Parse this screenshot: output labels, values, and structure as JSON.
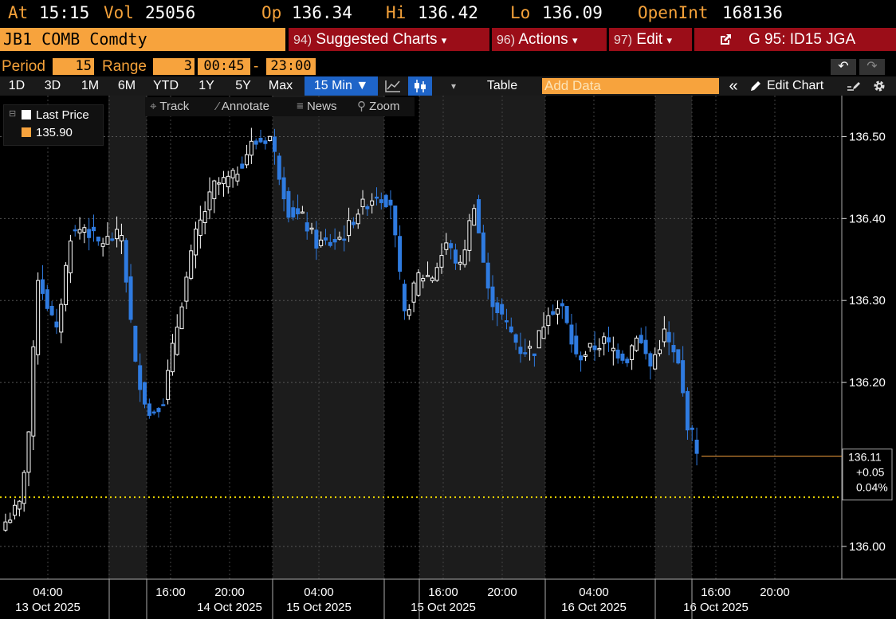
{
  "header": {
    "at_label": "At",
    "at_value": "15:15",
    "vol_label": "Vol",
    "vol_value": "25056",
    "op_label": "Op",
    "op_value": "136.34",
    "hi_label": "Hi",
    "hi_value": "136.42",
    "lo_label": "Lo",
    "lo_value": "136.09",
    "oi_label": "OpenInt",
    "oi_value": "168136"
  },
  "ticker": {
    "value": "JB1 COMB Comdty"
  },
  "menus": {
    "suggested": {
      "num": "94)",
      "label": "Suggested Charts",
      "arrow": "▾"
    },
    "actions": {
      "num": "96)",
      "label": "Actions",
      "arrow": "▾"
    },
    "edit": {
      "num": "97)",
      "label": "Edit",
      "arrow": "▾"
    },
    "launch": {
      "label": "G 95: ID15 JGA"
    }
  },
  "params": {
    "period_label": "Period",
    "period_value": "15",
    "range_label": "Range",
    "range_value": "3",
    "start_time": "00:45",
    "range_sep": "-",
    "end_time": "23:00",
    "undo": "↶",
    "redo": "↷"
  },
  "toolbar": {
    "ranges": [
      "1D",
      "3D",
      "1M",
      "6M",
      "YTD",
      "1Y",
      "5Y",
      "Max"
    ],
    "interval": "15 Min ▼",
    "table": "Table",
    "add_data_placeholder": "Add Data",
    "collapse": "«",
    "edit_chart": "Edit Chart"
  },
  "tools": {
    "track": "Track",
    "annotate": "Annotate",
    "news": "News",
    "zoom": "Zoom"
  },
  "legend": {
    "series": "Last Price",
    "value": "135.90",
    "swatch_color": "#f7a33d"
  },
  "colors": {
    "accent": "#f7a33d",
    "menu_red": "#9b0d18",
    "selected_blue": "#1e64c8",
    "down_candle": "#2f7be0"
  },
  "chart_data": {
    "type": "candlestick",
    "ylim": [
      135.96,
      136.55
    ],
    "yticks": [
      {
        "value": 136.5,
        "label": "136.50"
      },
      {
        "value": 136.4,
        "label": "136.40"
      },
      {
        "value": 136.3,
        "label": "136.30"
      },
      {
        "value": 136.2,
        "label": "136.20"
      },
      {
        "value": 136.0,
        "label": "136.00"
      }
    ],
    "xticks": [
      {
        "time": "04:00",
        "date": "13 Oct 2025"
      },
      {
        "time": "16:00",
        "date": ""
      },
      {
        "time": "20:00",
        "date": "14 Oct 2025"
      },
      {
        "time": "04:00",
        "date": "15 Oct 2025"
      },
      {
        "time": "16:00",
        "date": "15 Oct 2025"
      },
      {
        "time": "20:00",
        "date": ""
      },
      {
        "time": "04:00",
        "date": "16 Oct 2025"
      },
      {
        "time": "16:00",
        "date": "16 Oct 2025"
      },
      {
        "time": "20:00",
        "date": ""
      }
    ],
    "last_price": {
      "value": 136.11,
      "label": "136.11",
      "change": "+0.05",
      "pct": "0.04%"
    },
    "reference_level": 136.06,
    "control_points": [
      [
        0,
        136.03
      ],
      [
        3,
        136.05
      ],
      [
        5,
        136.14
      ],
      [
        7,
        136.33
      ],
      [
        11,
        136.26
      ],
      [
        14,
        136.38
      ],
      [
        17,
        136.39
      ],
      [
        20,
        136.37
      ],
      [
        25,
        136.38
      ],
      [
        28,
        136.22
      ],
      [
        31,
        136.16
      ],
      [
        34,
        136.18
      ],
      [
        38,
        136.3
      ],
      [
        41,
        136.38
      ],
      [
        45,
        136.44
      ],
      [
        49,
        136.45
      ],
      [
        53,
        136.49
      ],
      [
        57,
        136.5
      ],
      [
        61,
        136.41
      ],
      [
        64,
        136.4
      ],
      [
        67,
        136.37
      ],
      [
        70,
        136.37
      ],
      [
        73,
        136.38
      ],
      [
        76,
        136.41
      ],
      [
        80,
        136.43
      ],
      [
        83,
        136.42
      ],
      [
        86,
        136.28
      ],
      [
        89,
        136.33
      ],
      [
        92,
        136.33
      ],
      [
        95,
        136.37
      ],
      [
        98,
        136.34
      ],
      [
        101,
        136.42
      ],
      [
        104,
        136.31
      ],
      [
        107,
        136.28
      ],
      [
        111,
        136.24
      ],
      [
        114,
        136.24
      ],
      [
        117,
        136.29
      ],
      [
        120,
        136.29
      ],
      [
        123,
        136.23
      ],
      [
        126,
        136.24
      ],
      [
        129,
        136.25
      ],
      [
        131,
        136.24
      ],
      [
        134,
        136.23
      ],
      [
        136,
        136.26
      ],
      [
        139,
        136.22
      ],
      [
        142,
        136.26
      ],
      [
        145,
        136.22
      ],
      [
        147,
        136.15
      ],
      [
        149,
        136.12
      ]
    ]
  }
}
